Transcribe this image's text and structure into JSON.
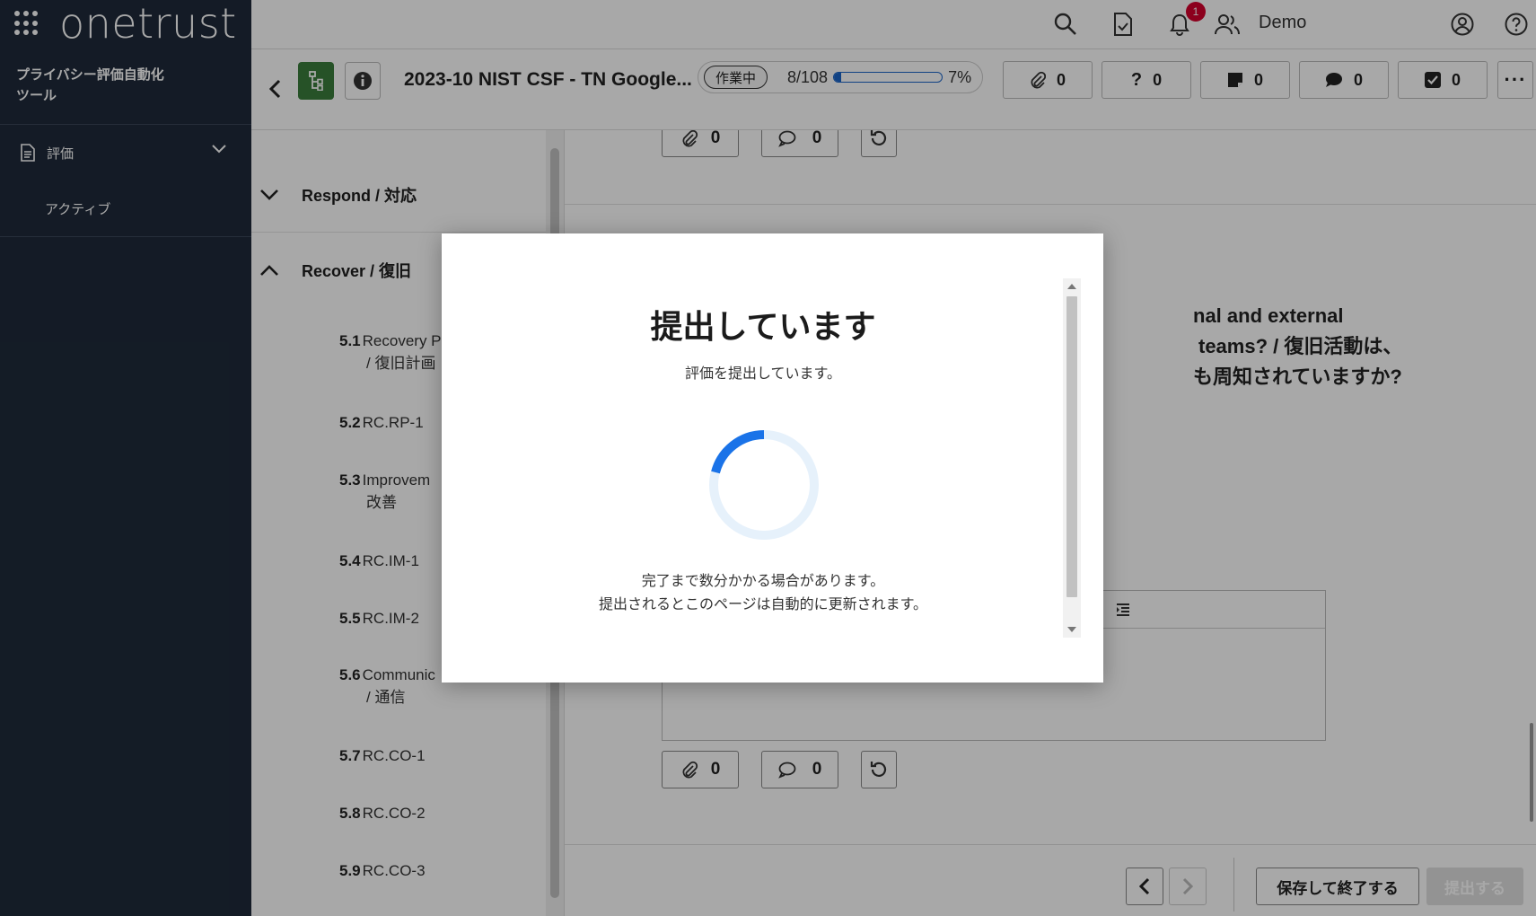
{
  "sidebar": {
    "logo": "onetrust",
    "app_name_line1": "プライバシー評価自動化",
    "app_name_line2": "ツール",
    "nav_parent": "評価",
    "nav_child": "アクティブ"
  },
  "header": {
    "user_name": "Demo",
    "notification_count": "1"
  },
  "toolbar": {
    "assessment_title": "2023-10 NIST CSF - TN Google...",
    "status": "作業中",
    "progress_text": "8/108",
    "progress_percent_label": "7%",
    "progress_fraction": 0.07,
    "counts": {
      "attachments": "0",
      "questions": "0",
      "notes": "0",
      "comments": "0",
      "tasks": "0"
    },
    "more_label": "···"
  },
  "tree": {
    "sections": [
      {
        "label": "Respond / 対応",
        "expanded": false
      },
      {
        "label": "Recover / 復旧",
        "expanded": true
      }
    ],
    "items": [
      {
        "num": "5.1",
        "line1": "Recovery P",
        "line2": "/ 復旧計画"
      },
      {
        "num": "5.2",
        "line1": "RC.RP-1",
        "line2": ""
      },
      {
        "num": "5.3",
        "line1": "Improvem",
        "line2": "改善"
      },
      {
        "num": "5.4",
        "line1": "RC.IM-1",
        "line2": ""
      },
      {
        "num": "5.5",
        "line1": "RC.IM-2",
        "line2": ""
      },
      {
        "num": "5.6",
        "line1": "Communic",
        "line2": "/ 通信"
      },
      {
        "num": "5.7",
        "line1": "RC.CO-1",
        "line2": ""
      },
      {
        "num": "5.8",
        "line1": "RC.CO-2",
        "line2": ""
      },
      {
        "num": "5.9",
        "line1": "RC.CO-3",
        "line2": ""
      }
    ]
  },
  "main": {
    "question_line1": "nal and external",
    "question_line2": "teams? / 復旧活動は、",
    "question_line3": "も周知されていますか?",
    "attach_count_top": "0",
    "comment_count_top": "0",
    "attach_count": "0",
    "comment_count": "0"
  },
  "footer": {
    "save_label": "保存して終了する",
    "submit_label": "提出する"
  },
  "modal": {
    "title": "提出しています",
    "subtitle": "評価を提出しています。",
    "note_line1": "完了まで数分かかる場合があります。",
    "note_line2": "提出されるとこのページは自動的に更新されます。"
  },
  "colors": {
    "sidebar_bg": "#1f2a3a",
    "accent_green": "#3b7d3c",
    "progress_blue": "#1b64c8",
    "badge_red": "#d5002d"
  }
}
